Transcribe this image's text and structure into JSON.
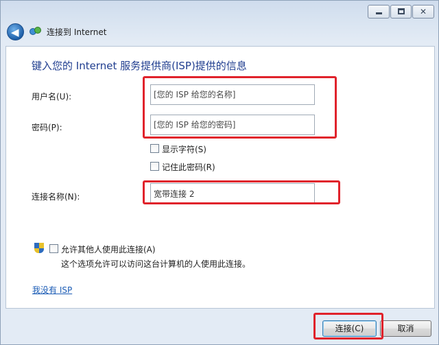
{
  "window": {
    "title": "连接到 Internet",
    "controls": {
      "minimize": "minimize-icon",
      "maximize": "maximize-icon",
      "close": "close-icon"
    }
  },
  "form": {
    "heading": "键入您的 Internet 服务提供商(ISP)提供的信息",
    "username": {
      "label": "用户名(U):",
      "placeholder": "[您的 ISP 给您的名称]",
      "value": ""
    },
    "password": {
      "label": "密码(P):",
      "placeholder": "[您的 ISP 给您的密码]",
      "value": ""
    },
    "show_chars": {
      "label": "显示字符(S)",
      "checked": false
    },
    "remember": {
      "label": "记住此密码(R)",
      "checked": false
    },
    "connection_name": {
      "label": "连接名称(N):",
      "value": "宽带连接 2"
    },
    "allow_others": {
      "label": "允许其他人使用此连接(A)",
      "checked": false,
      "note": "这个选项允许可以访问这台计算机的人使用此连接。"
    },
    "no_isp_link": "我没有 ISP"
  },
  "buttons": {
    "connect": "连接(C)",
    "cancel": "取消"
  },
  "colors": {
    "highlight": "#e0222b",
    "heading": "#1f3d8f",
    "link": "#1a5bb5"
  }
}
